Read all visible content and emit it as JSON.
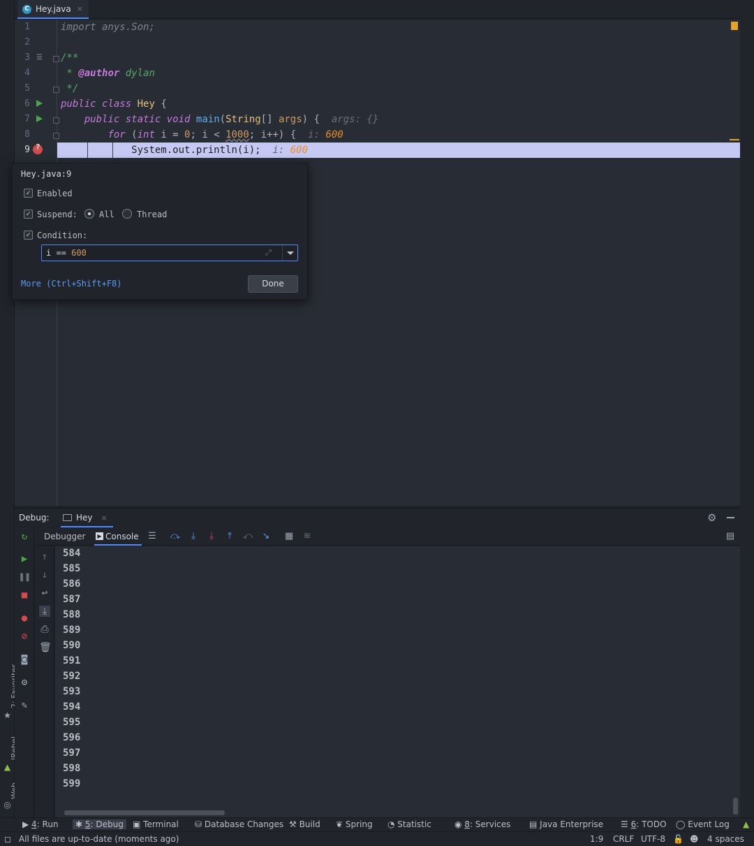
{
  "editor": {
    "tab": {
      "label": "Hey.java",
      "icon": "java-class-icon",
      "close": "×"
    },
    "lines": [
      {
        "n": "1"
      },
      {
        "n": "2"
      },
      {
        "n": "3"
      },
      {
        "n": "4"
      },
      {
        "n": "5"
      },
      {
        "n": "6"
      },
      {
        "n": "7"
      },
      {
        "n": "8"
      },
      {
        "n": "9"
      }
    ],
    "code": {
      "l1_kw": "import",
      "l1_rest": " anys.Son;",
      "l3": "/**",
      "l4_star": " * ",
      "l4_tag": "@author",
      "l4_name": " dylan",
      "l5": " */",
      "l6_kw1": "public",
      "l6_kw2": "class",
      "l6_cls": "Hey",
      "l6_brace": " {",
      "l7_kw1": "public",
      "l7_kw2": "static",
      "l7_kw3": "void",
      "l7_fn": "main",
      "l7_p1": "(",
      "l7_type": "String",
      "l7_p2": "[] ",
      "l7_arg": "args",
      "l7_p3": ") {",
      "l7_inlay_k": "args:",
      "l7_inlay_v": "{}",
      "l8_kw": "for",
      "l8_p1": " (",
      "l8_int": "int",
      "l8_p2": " i = ",
      "l8_zero": "0",
      "l8_p3": "; i < ",
      "l8_lim": "1000",
      "l8_p4": "; i++) {",
      "l8_inlay_k": "i:",
      "l8_inlay_v": "600",
      "l9_code": "System.out.println(i);",
      "l9_inlay_k": "i:",
      "l9_inlay_v": "600"
    }
  },
  "breakpoint_popup": {
    "title": "Hey.java:9",
    "enabled_label": "Enabled",
    "suspend_label": "Suspend:",
    "all_label": "All",
    "thread_label": "Thread",
    "condition_label": "Condition:",
    "condition_var": "i == ",
    "condition_num": "600",
    "more_link": "More (Ctrl+Shift+F8)",
    "done_label": "Done"
  },
  "debug": {
    "header_label": "Debug:",
    "session_tab": "Hey",
    "tabs": {
      "debugger": "Debugger",
      "console": "Console"
    }
  },
  "console_output": [
    "584",
    "585",
    "586",
    "587",
    "588",
    "589",
    "590",
    "591",
    "592",
    "593",
    "594",
    "595",
    "596",
    "597",
    "598",
    "599"
  ],
  "left_strip": {
    "favorites": "2: Favorites",
    "jrebel": "JRebel",
    "web": "Web"
  },
  "tool_windows": [
    {
      "key": "4",
      "label": ": Run"
    },
    {
      "key": "5",
      "label": ": Debug"
    },
    {
      "key": "",
      "label": "Terminal"
    },
    {
      "key": "",
      "label": "Database Changes"
    },
    {
      "key": "",
      "label": "Build"
    },
    {
      "key": "",
      "label": "Spring"
    },
    {
      "key": "",
      "label": "Statistic"
    },
    {
      "key": "8",
      "label": ": Services"
    },
    {
      "key": "",
      "label": "Java Enterprise"
    },
    {
      "key": "6",
      "label": ": TODO"
    },
    {
      "key": "",
      "label": "Event Log"
    }
  ],
  "status": {
    "message": "All files are up-to-date (moments ago)",
    "position": "1:9",
    "line_sep": "CRLF",
    "encoding": "UTF-8",
    "indent": "4 spaces"
  },
  "colors": {
    "accent": "#528bff",
    "breakpoint": "#d04d4d",
    "highlight_line": "#c7c9f5",
    "inlay_value": "#e78c2b"
  }
}
